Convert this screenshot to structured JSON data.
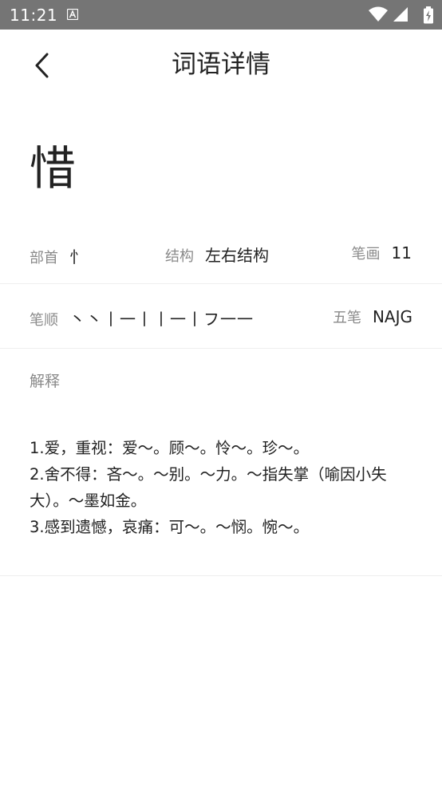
{
  "status_bar": {
    "time": "11:21",
    "notification_icon": "font-a-icon",
    "icons": [
      "wifi-icon",
      "signal-icon",
      "battery-charging-icon"
    ]
  },
  "app_bar": {
    "back_icon": "chevron-left-icon",
    "title": "词语详情"
  },
  "character": "惜",
  "info": {
    "radical_label": "部首",
    "radical_value": "忄",
    "structure_label": "结构",
    "structure_value": "左右结构",
    "strokes_label": "笔画",
    "strokes_value": "11",
    "stroke_order_label": "笔顺",
    "stroke_order_value": "丶丶丨一丨丨一丨フ一一",
    "wubi_label": "五笔",
    "wubi_value": "NAJG"
  },
  "explanation": {
    "title": "解释",
    "lines": [
      "1.爱，重视：爱～。顾～。怜～。珍～。",
      "2.舍不得：吝～。～别。～力。～指失掌（喻因小失大）。～墨如金。",
      "3.感到遗憾，哀痛：可～。～悯。惋～。"
    ]
  },
  "colors": {
    "status_bar": "#757575",
    "label": "#8a8a8a",
    "text": "#222222",
    "divider": "#eeeeee"
  }
}
